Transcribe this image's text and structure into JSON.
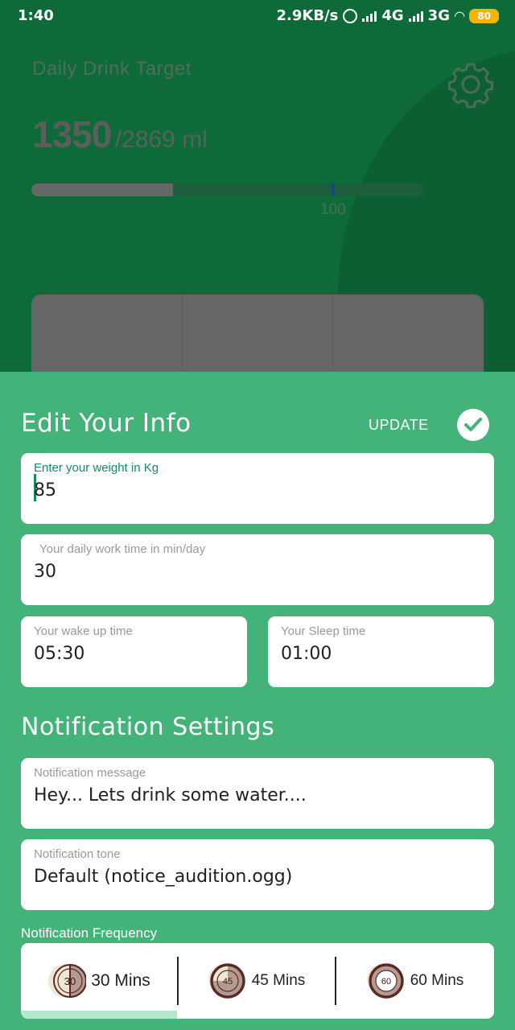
{
  "status_bar": {
    "time": "1:40",
    "speed": "2.9KB/s",
    "network1": "4G",
    "network2": "3G",
    "battery": "80"
  },
  "background": {
    "title": "Daily Drink Target",
    "current": "1350",
    "goal": "/2869 ml",
    "progress_fraction": 0.36,
    "progress_label": "100"
  },
  "edit": {
    "title": "Edit Your Info",
    "update_label": "UPDATE",
    "weight": {
      "label": "Enter your weight in Kg",
      "value": "85"
    },
    "work_time": {
      "label": "Your daily work time in min/day",
      "value": "30"
    },
    "wake_time": {
      "label": "Your wake up time",
      "value": "05:30"
    },
    "sleep_time": {
      "label": "Your Sleep time",
      "value": "01:00"
    }
  },
  "notifications": {
    "title": "Notification Settings",
    "message": {
      "label": "Notification message",
      "value": "Hey... Lets drink some water...."
    },
    "tone": {
      "label": "Notification tone",
      "value": "Default (notice_audition.ogg)"
    },
    "frequency": {
      "label": "Notification Frequency",
      "options": [
        {
          "icon_text": "30",
          "label": "30 Mins",
          "selected": true
        },
        {
          "icon_text": "45",
          "label": "45 Mins",
          "selected": false
        },
        {
          "icon_text": "60",
          "label": "60 Mins",
          "selected": false
        }
      ]
    }
  },
  "colors": {
    "sheet": "#43b37a",
    "accent": "#188a62",
    "clock": "#5a2a22",
    "clock_fill": "#b59a94"
  }
}
